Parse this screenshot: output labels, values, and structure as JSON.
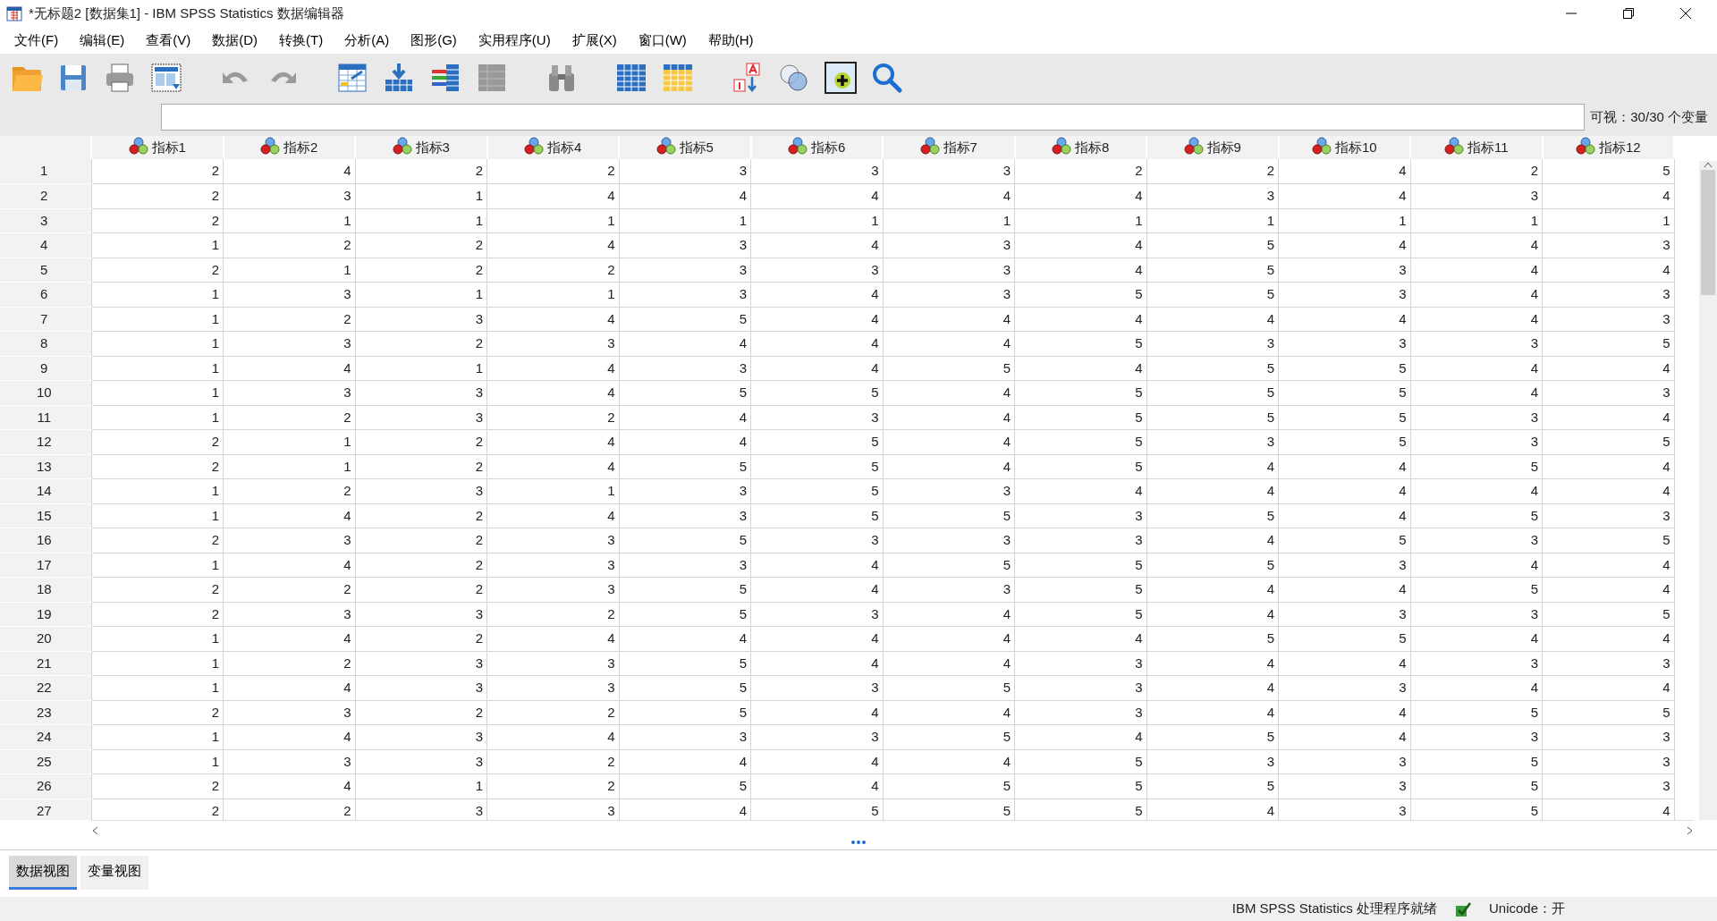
{
  "window": {
    "title": "*无标题2 [数据集1] - IBM SPSS Statistics 数据编辑器"
  },
  "menu": [
    "文件(F)",
    "编辑(E)",
    "查看(V)",
    "数据(D)",
    "转换(T)",
    "分析(A)",
    "图形(G)",
    "实用程序(U)",
    "扩展(X)",
    "窗口(W)",
    "帮助(H)"
  ],
  "visible_vars": "可视：30/30 个变量",
  "table": {
    "columns": [
      "指标1",
      "指标2",
      "指标3",
      "指标4",
      "指标5",
      "指标6",
      "指标7",
      "指标8",
      "指标9",
      "指标10",
      "指标11",
      "指标12"
    ],
    "rows": [
      {
        "n": "1",
        "cells": [
          "2",
          "4",
          "2",
          "2",
          "3",
          "3",
          "3",
          "2",
          "2",
          "4",
          "2",
          "5"
        ]
      },
      {
        "n": "2",
        "cells": [
          "2",
          "3",
          "1",
          "4",
          "4",
          "4",
          "4",
          "4",
          "3",
          "4",
          "3",
          "4"
        ]
      },
      {
        "n": "3",
        "cells": [
          "2",
          "1",
          "1",
          "1",
          "1",
          "1",
          "1",
          "1",
          "1",
          "1",
          "1",
          "1"
        ]
      },
      {
        "n": "4",
        "cells": [
          "1",
          "2",
          "2",
          "4",
          "3",
          "4",
          "3",
          "4",
          "5",
          "4",
          "4",
          "3"
        ]
      },
      {
        "n": "5",
        "cells": [
          "2",
          "1",
          "2",
          "2",
          "3",
          "3",
          "3",
          "4",
          "5",
          "3",
          "4",
          "4"
        ]
      },
      {
        "n": "6",
        "cells": [
          "1",
          "3",
          "1",
          "1",
          "3",
          "4",
          "3",
          "5",
          "5",
          "3",
          "4",
          "3"
        ]
      },
      {
        "n": "7",
        "cells": [
          "1",
          "2",
          "3",
          "4",
          "5",
          "4",
          "4",
          "4",
          "4",
          "4",
          "4",
          "3"
        ]
      },
      {
        "n": "8",
        "cells": [
          "1",
          "3",
          "2",
          "3",
          "4",
          "4",
          "4",
          "5",
          "3",
          "3",
          "3",
          "5"
        ]
      },
      {
        "n": "9",
        "cells": [
          "1",
          "4",
          "1",
          "4",
          "3",
          "4",
          "5",
          "4",
          "5",
          "5",
          "4",
          "4"
        ]
      },
      {
        "n": "10",
        "cells": [
          "1",
          "3",
          "3",
          "4",
          "5",
          "5",
          "4",
          "5",
          "5",
          "5",
          "4",
          "3"
        ]
      },
      {
        "n": "11",
        "cells": [
          "1",
          "2",
          "3",
          "2",
          "4",
          "3",
          "4",
          "5",
          "5",
          "5",
          "3",
          "4"
        ]
      },
      {
        "n": "12",
        "cells": [
          "2",
          "1",
          "2",
          "4",
          "4",
          "5",
          "4",
          "5",
          "3",
          "5",
          "3",
          "5"
        ]
      },
      {
        "n": "13",
        "cells": [
          "2",
          "1",
          "2",
          "4",
          "5",
          "5",
          "4",
          "5",
          "4",
          "4",
          "5",
          "4"
        ]
      },
      {
        "n": "14",
        "cells": [
          "1",
          "2",
          "3",
          "1",
          "3",
          "5",
          "3",
          "4",
          "4",
          "4",
          "4",
          "4"
        ]
      },
      {
        "n": "15",
        "cells": [
          "1",
          "4",
          "2",
          "4",
          "3",
          "5",
          "5",
          "3",
          "5",
          "4",
          "5",
          "3"
        ]
      },
      {
        "n": "16",
        "cells": [
          "2",
          "3",
          "2",
          "3",
          "5",
          "3",
          "3",
          "3",
          "4",
          "5",
          "3",
          "5"
        ]
      },
      {
        "n": "17",
        "cells": [
          "1",
          "4",
          "2",
          "3",
          "3",
          "4",
          "5",
          "5",
          "5",
          "3",
          "4",
          "4"
        ]
      },
      {
        "n": "18",
        "cells": [
          "2",
          "2",
          "2",
          "3",
          "5",
          "4",
          "3",
          "5",
          "4",
          "4",
          "5",
          "4"
        ]
      },
      {
        "n": "19",
        "cells": [
          "2",
          "3",
          "3",
          "2",
          "5",
          "3",
          "4",
          "5",
          "4",
          "3",
          "3",
          "5"
        ]
      },
      {
        "n": "20",
        "cells": [
          "1",
          "4",
          "2",
          "4",
          "4",
          "4",
          "4",
          "4",
          "5",
          "5",
          "4",
          "4"
        ]
      },
      {
        "n": "21",
        "cells": [
          "1",
          "2",
          "3",
          "3",
          "5",
          "4",
          "4",
          "3",
          "4",
          "4",
          "3",
          "3"
        ]
      },
      {
        "n": "22",
        "cells": [
          "1",
          "4",
          "3",
          "3",
          "5",
          "3",
          "5",
          "3",
          "4",
          "3",
          "4",
          "4"
        ]
      },
      {
        "n": "23",
        "cells": [
          "2",
          "3",
          "2",
          "2",
          "5",
          "4",
          "4",
          "3",
          "4",
          "4",
          "5",
          "5"
        ]
      },
      {
        "n": "24",
        "cells": [
          "1",
          "4",
          "3",
          "4",
          "3",
          "3",
          "5",
          "4",
          "5",
          "4",
          "3",
          "3"
        ]
      },
      {
        "n": "25",
        "cells": [
          "1",
          "3",
          "3",
          "2",
          "4",
          "4",
          "4",
          "5",
          "3",
          "3",
          "5",
          "3"
        ]
      },
      {
        "n": "26",
        "cells": [
          "2",
          "4",
          "1",
          "2",
          "5",
          "4",
          "5",
          "5",
          "5",
          "3",
          "5",
          "3"
        ]
      },
      {
        "n": "27",
        "cells": [
          "2",
          "2",
          "3",
          "3",
          "4",
          "5",
          "5",
          "5",
          "4",
          "3",
          "5",
          "4"
        ]
      }
    ]
  },
  "tabs": [
    {
      "label": "数据视图",
      "selected": true
    },
    {
      "label": "变量视图",
      "selected": false
    }
  ],
  "status_bar": {
    "message": "IBM SPSS Statistics 处理程序就绪",
    "encoding": "Unicode：开"
  }
}
